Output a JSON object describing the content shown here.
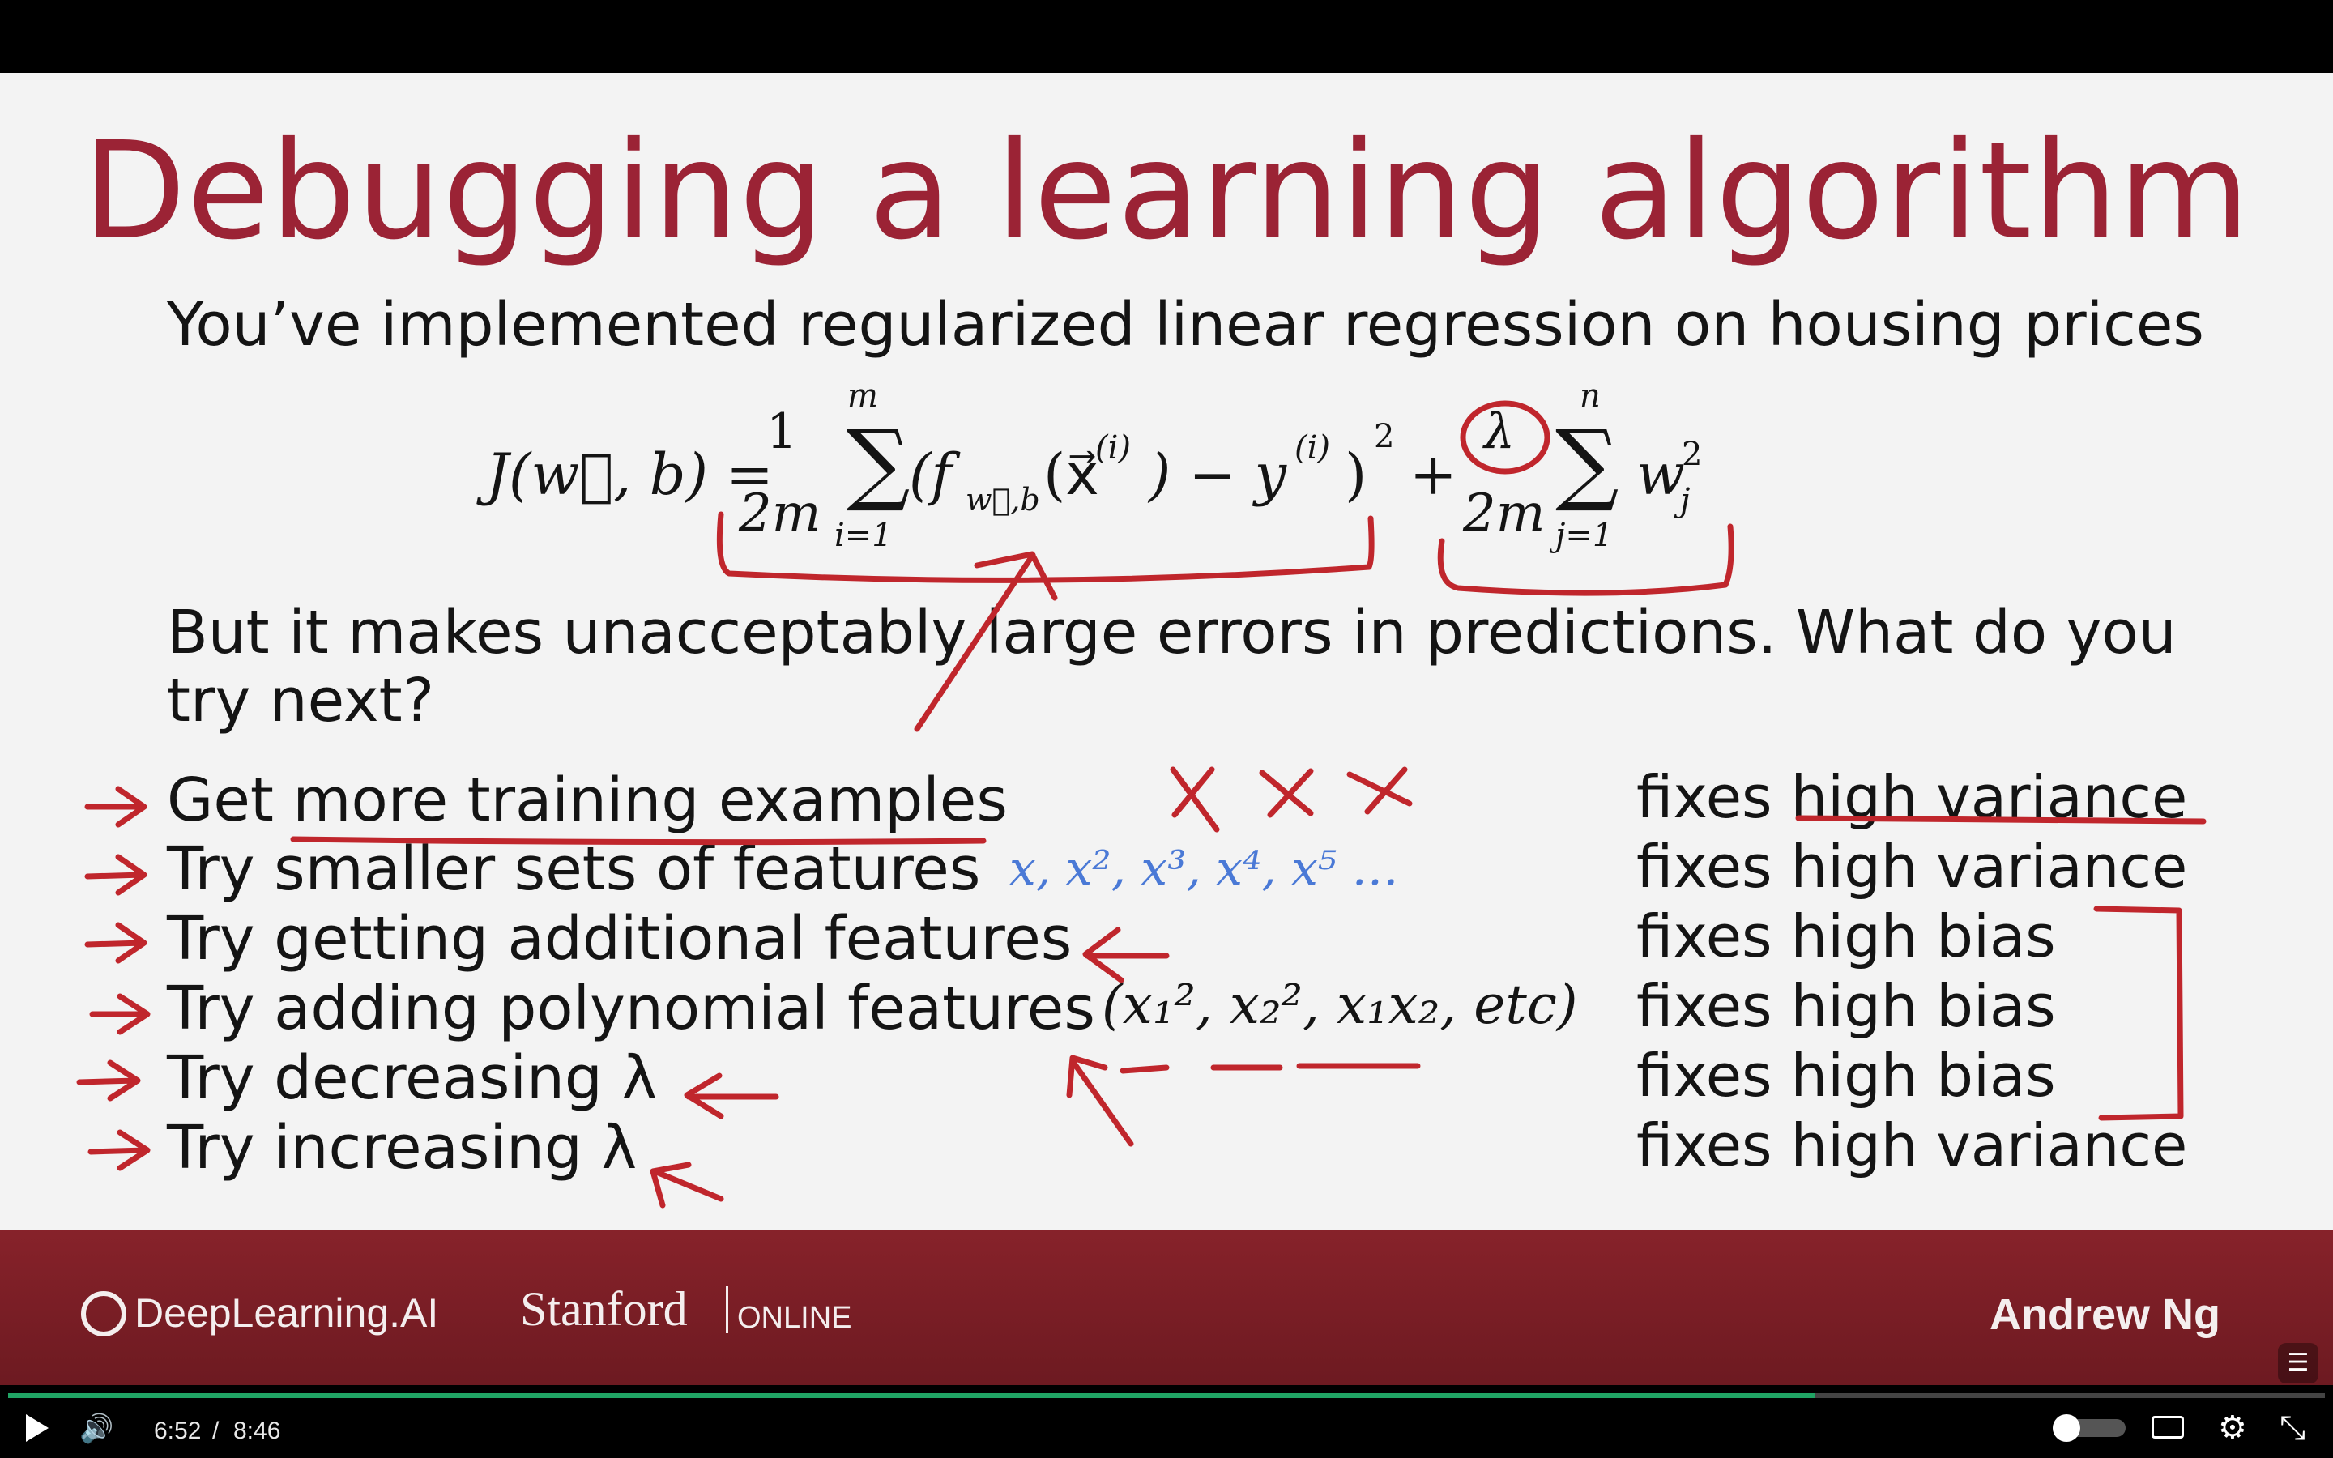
{
  "slide": {
    "title": "Debugging a learning algorithm",
    "intro": "You’ve implemented regularized linear regression on housing prices",
    "question_line1": "But it makes unacceptably large errors in predictions. What do you",
    "question_line2": "try next?",
    "equation": {
      "lhs": "J(w⃗, b) =",
      "frac1_num": "1",
      "frac1_den": "2m",
      "sum1_top": "m",
      "sum1_bottom": "i=1",
      "term1": "(f",
      "term1_sub": "w⃗,b",
      "term1_rest": "(x⃗",
      "term1_sup": "(i)",
      "term1_minus": ") − y",
      "term1_sup2": "(i)",
      "term1_close": ")",
      "term1_sq": "2",
      "plus": "+",
      "lambda": "λ",
      "frac2_den": "2m",
      "sum2_top": "n",
      "sum2_bottom": "j=1",
      "w": "w",
      "w_sub": "j",
      "w_sup": "2"
    },
    "options": [
      {
        "text": "Get more training examples",
        "fix": "fixes high variance"
      },
      {
        "text": "Try smaller sets of features",
        "fix": "fixes high variance"
      },
      {
        "text": "Try getting additional features",
        "fix": "fixes high bias"
      },
      {
        "text": "Try adding polynomial features",
        "fix": "fixes high bias"
      },
      {
        "text": "Try decreasing λ",
        "fix": "fixes high bias"
      },
      {
        "text": "Try increasing λ",
        "fix": "fixes high variance"
      }
    ],
    "poly_features": "(x₁², x₂², x₁x₂, etc)",
    "handwritten_features": "x, x², x³, x⁴, x⁵ …"
  },
  "footer": {
    "brand": "DeepLearning.AI",
    "stanford": "Stanford",
    "online": "ONLINE",
    "presenter": "Andrew Ng"
  },
  "player": {
    "current_time": "6:52",
    "separator": "/",
    "duration": "8:46",
    "progress": 0.78
  },
  "colors": {
    "accent": "#9b2335",
    "ink": "#c0262c",
    "blue_ink": "#4a79d6",
    "footer": "#7c1f27",
    "progress": "#20a464"
  }
}
